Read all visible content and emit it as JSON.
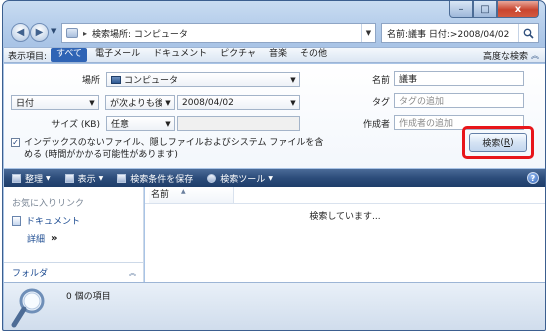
{
  "window": {
    "minimize_glyph": "–",
    "maximize_glyph": "□",
    "close_glyph": "x"
  },
  "nav": {
    "back_glyph": "◀",
    "forward_glyph": "▶",
    "address_separator": "▸",
    "address_text": "検索場所: コンピュータ",
    "search_query": "名前:議事 日付:>2008/04/02"
  },
  "filter": {
    "label": "表示項目:",
    "tabs": [
      "すべて",
      "電子メール",
      "ドキュメント",
      "ピクチャ",
      "音楽",
      "その他"
    ],
    "advanced_label": "高度な検索"
  },
  "advanced": {
    "location_label": "場所",
    "location_value": "コンピュータ",
    "date_field": "日付",
    "date_operator": "が次よりも後",
    "date_value": "2008/04/02",
    "size_label": "サイズ (KB)",
    "size_value": "任意",
    "name_label": "名前",
    "name_value": "議事",
    "tag_label": "タグ",
    "tag_placeholder": "タグの追加",
    "author_label": "作成者",
    "author_placeholder": "作成者の追加",
    "checkbox_text": "インデックスのないファイル、隠しファイルおよびシステム ファイルを含める (時間がかかる可能性があります)",
    "search_button": "検索",
    "search_button_key": "R"
  },
  "toolbar": {
    "organize": "整理",
    "view": "表示",
    "save_search": "検索条件を保存",
    "search_tools": "検索ツール",
    "help_glyph": "?"
  },
  "navpane": {
    "favorites_title": "お気に入りリンク",
    "documents": "ドキュメント",
    "details": "詳細",
    "details_glyph": "»",
    "folders": "フォルダ"
  },
  "filelist": {
    "column_name": "名前",
    "status": "検索しています..."
  },
  "details": {
    "item_count": "0 個の項目"
  },
  "colors": {
    "accent": "#2f64b5",
    "toolbar": "#2c4c7a",
    "highlight": "#e8151a"
  }
}
